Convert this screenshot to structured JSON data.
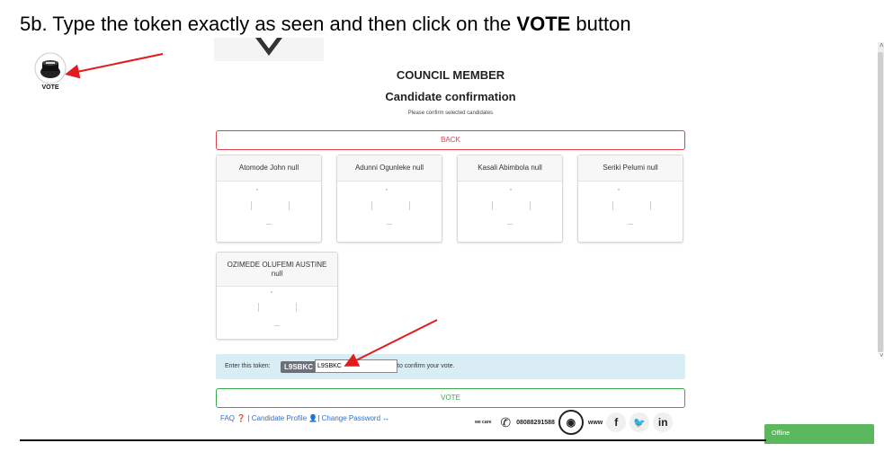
{
  "instruction": {
    "prefix": "5b. Type the token exactly as seen and then click on the ",
    "bold": "VOTE",
    "suffix": " button"
  },
  "logo": {
    "label": "VOTE",
    "icon": "ballot-box-icon"
  },
  "heading": {
    "title": "COUNCIL MEMBER",
    "subtitle": "Candidate confirmation",
    "note": "Please confirm selected candidates"
  },
  "back_label": "BACK",
  "candidates": [
    {
      "name": "Atomode John null"
    },
    {
      "name": "Adunni Ogunleke null"
    },
    {
      "name": "Kasali Abimbola null"
    },
    {
      "name": "Seriki Pelumi null"
    },
    {
      "name": "OZIMEDE OLUFEMI AUSTINE null"
    }
  ],
  "token": {
    "label": "Enter this token:",
    "code": "L9SBKC",
    "input_value": "L9SBKC",
    "suffix": "to confirm your vote."
  },
  "vote_label": "VOTE",
  "footer": {
    "faq": "FAQ",
    "candidate_profile": "Candidate Profile",
    "change_password": "Change Password",
    "phone": "08088291588",
    "www": "www",
    "small_brand": "we care"
  },
  "status": {
    "offline": "Offline"
  },
  "colors": {
    "back": "#e0404a",
    "vote": "#3aa84b",
    "token_bg": "#d9eef4",
    "link": "#2f70c8",
    "offline": "#5cb85c",
    "arrow": "#e31b1b"
  }
}
